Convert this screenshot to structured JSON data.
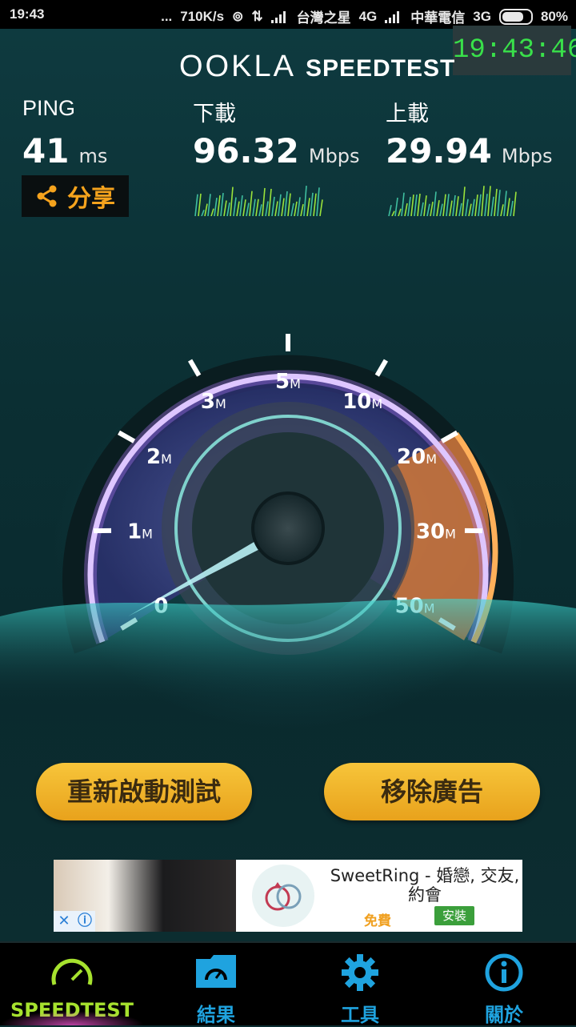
{
  "status_bar": {
    "time": "19:43",
    "dots": "...",
    "speed": "710K/s",
    "carrier1": "台灣之星",
    "network1": "4G",
    "carrier2": "中華電信",
    "network2": "3G",
    "battery": "80%"
  },
  "clock": "19:43:46",
  "logo": {
    "part1": "OOKLA",
    "part2": "SPEEDTEST"
  },
  "ping": {
    "label": "PING",
    "value": "41",
    "unit": "ms"
  },
  "download": {
    "label": "下載",
    "value": "96.32",
    "unit": "Mbps"
  },
  "upload": {
    "label": "上載",
    "value": "29.94",
    "unit": "Mbps"
  },
  "share_label": "分享",
  "gauge": {
    "ticks": [
      "0",
      "1",
      "2",
      "3",
      "5",
      "10",
      "20",
      "30",
      "50"
    ],
    "tick_unit": "M",
    "needle_value": 0
  },
  "buttons": {
    "restart": "重新啟動測試",
    "remove_ads": "移除廣告"
  },
  "ad": {
    "title": "SweetRing - 婚戀, 交友, 約會",
    "free": "免費",
    "install": "安裝",
    "close_glyph": "✕",
    "info_glyph": "ⓘ"
  },
  "nav": [
    {
      "label": "SPEEDTEST",
      "icon": "speedometer-icon",
      "color": "#a6e22e"
    },
    {
      "label": "結果",
      "icon": "folder-gauge-icon",
      "color": "#1fa3df"
    },
    {
      "label": "工具",
      "icon": "gear-icon",
      "color": "#1fa3df"
    },
    {
      "label": "關於",
      "icon": "info-icon",
      "color": "#1fa3df"
    }
  ],
  "colors": {
    "accent_green": "#39e04a",
    "button_gold": "#f0b02a",
    "nav_blue": "#1fa3df",
    "gauge_orange": "#e88a3a"
  }
}
